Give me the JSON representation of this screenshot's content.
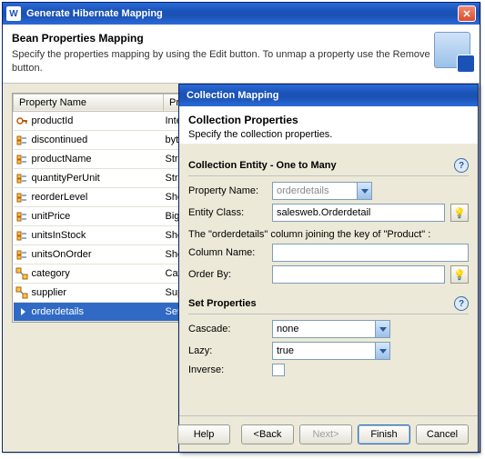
{
  "back": {
    "title": "Generate Hibernate Mapping",
    "heading": "Bean Properties Mapping",
    "description": "Specify the properties mapping by using the Edit button. To unmap a property use the Remove button.",
    "columns": {
      "c0": "Property Name",
      "c1": "Prop"
    },
    "rows": [
      {
        "name": "productId",
        "type": "Intege",
        "kind": "key"
      },
      {
        "name": "discontinued",
        "type": "byte",
        "kind": "field"
      },
      {
        "name": "productName",
        "type": "String",
        "kind": "field"
      },
      {
        "name": "quantityPerUnit",
        "type": "String",
        "kind": "field"
      },
      {
        "name": "reorderLevel",
        "type": "Short",
        "kind": "field"
      },
      {
        "name": "unitPrice",
        "type": "BigDe",
        "kind": "field"
      },
      {
        "name": "unitsInStock",
        "type": "Short",
        "kind": "field"
      },
      {
        "name": "unitsOnOrder",
        "type": "Short",
        "kind": "field"
      },
      {
        "name": "category",
        "type": "Categ",
        "kind": "assoc"
      },
      {
        "name": "supplier",
        "type": "Suppli",
        "kind": "assoc"
      },
      {
        "name": "orderdetails",
        "type": "Set<O",
        "kind": "coll",
        "selected": true
      }
    ]
  },
  "front": {
    "title": "Collection Mapping",
    "heading": "Collection Properties",
    "subheading": "Specify the collection properties.",
    "section_entity": "Collection Entity - One to Many",
    "labels": {
      "propertyName": "Property Name:",
      "entityClass": "Entity Class:",
      "columnName": "Column Name:",
      "orderBy": "Order By:",
      "cascade": "Cascade:",
      "lazy": "Lazy:",
      "inverse": "Inverse:"
    },
    "values": {
      "propertyName": "orderdetails",
      "entityClass": "salesweb.Orderdetail",
      "columnName": "",
      "orderBy": "",
      "cascade": "none",
      "lazy": "true"
    },
    "note": "The \"orderdetails\" column joining the key of \"Product\" :",
    "section_set": "Set Properties",
    "buttons": {
      "help": "Help",
      "back": "<Back",
      "next": "Next>",
      "finish": "Finish",
      "cancel": "Cancel"
    }
  }
}
